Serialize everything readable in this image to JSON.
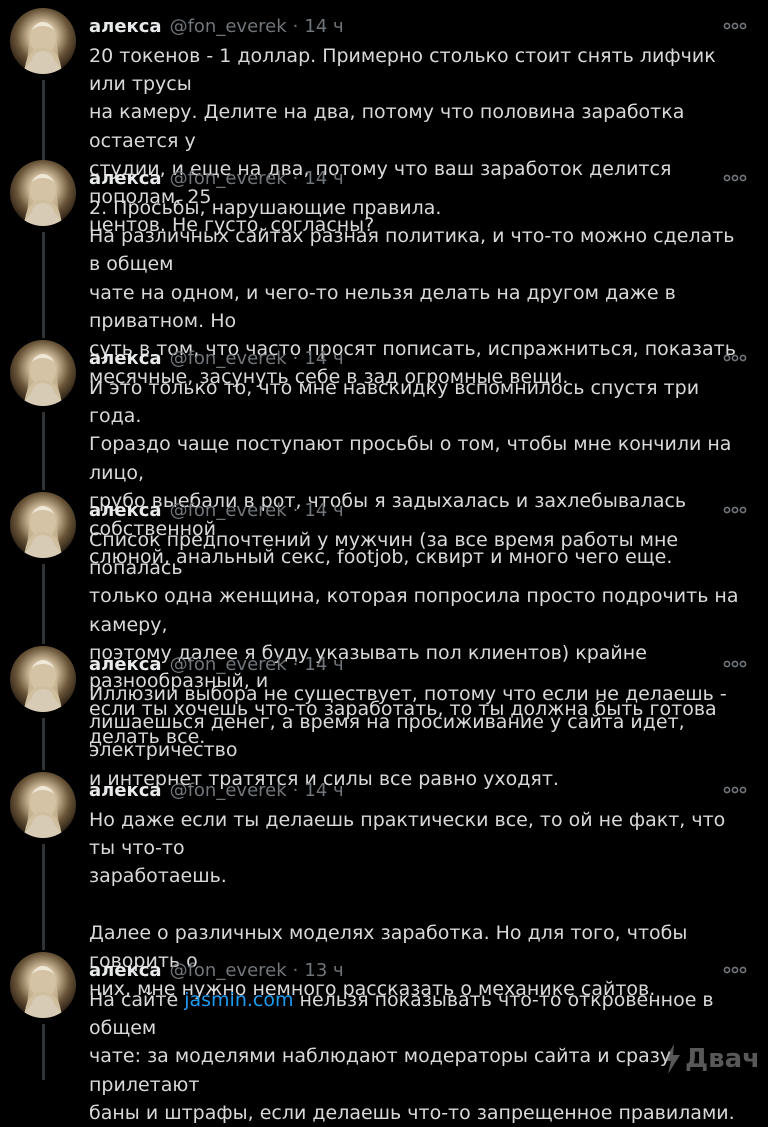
{
  "author": {
    "name": "алекса",
    "handle": "@fon_everek",
    "dot": "·"
  },
  "icons": {
    "avatar": "profile-photo-avatar",
    "more": "more-horizontal-icon",
    "watermark": "lightning-bolt-icon"
  },
  "colors": {
    "background": "#000000",
    "text": "#d9d9d9",
    "muted": "#71767b",
    "link": "#1d9bf0",
    "thread_line": "#2f3336"
  },
  "tweets": [
    {
      "time": "14 ч",
      "text": "20 токенов - 1 доллар. Примерно столько стоит снять лифчик или трусы\nна камеру. Делите на два, потому что половина заработка остается у\nстудии, и еще на два, потому что ваш заработок делится пополам. 25\nцентов. Не густо, согласны?"
    },
    {
      "time": "14 ч",
      "text": "2. Просьбы, нарушающие правила.\nНа различных сайтах разная политика, и что-то можно сделать в общем\nчате на одном, и чего-то нельзя делать на другом даже в приватном. Но\nсуть в том, что часто просят пописать, испражниться, показать\nмесячные, засунуть себе в зад огромные вещи."
    },
    {
      "time": "14 ч",
      "text": "И это только то, что мне навскидку вспомнилось спустя три года.\nГораздо чаще поступают просьбы о том, чтобы мне кончили на лицо,\nгрубо выебали в рот, чтобы я задыхалась и захлебывалась собственной\nслюной, анальный секс, footjob, сквирт и много чего еще."
    },
    {
      "time": "14 ч",
      "text": "Список предпочтений у мужчин (за все время работы мне попалась\nтолько одна женщина, которая попросила просто подрочить на камеру,\nпоэтому далее я буду указывать пол клиентов) крайне разнообразный, и\nесли ты хочешь что-то заработать, то ты должна быть готова делать все."
    },
    {
      "time": "14 ч",
      "text": "Иллюзии выбора не существует, потому что если не делаешь -\nлишаешься денег, а время на просиживание у сайта идет, электричество\nи интернет тратятся и силы все равно уходят."
    },
    {
      "time": "14 ч",
      "text": "Но даже если ты делаешь практически все, то ой не факт, что ты что-то\nзаработаешь.\n\nДалее о различных моделях заработка. Но для того, чтобы говорить о\nних, мне нужно немного рассказать о механике сайтов."
    },
    {
      "time": "13 ч",
      "text_before": "На сайте ",
      "link": "jasmin.com",
      "text_after": " нельзя показывать что-то откровенное в общем\nчате: за моделями наблюдают модераторы сайта и сразу прилетают\nбаны и штрафы, если делаешь что-то запрещенное правилами."
    }
  ],
  "watermark": {
    "text": "Двач"
  }
}
